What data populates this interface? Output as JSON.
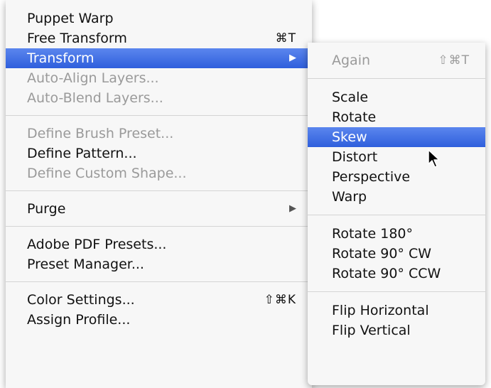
{
  "main_menu": {
    "items": [
      {
        "label": "Puppet Warp",
        "shortcut": "",
        "enabled": true
      },
      {
        "label": "Free Transform",
        "shortcut": "⌘T",
        "enabled": true
      },
      {
        "label": "Transform",
        "shortcut": "",
        "enabled": true,
        "highlighted": true,
        "submenu_arrow": "▶"
      },
      {
        "label": "Auto-Align Layers...",
        "shortcut": "",
        "enabled": false
      },
      {
        "label": "Auto-Blend Layers...",
        "shortcut": "",
        "enabled": false
      },
      {
        "label": "Define Brush Preset...",
        "shortcut": "",
        "enabled": false
      },
      {
        "label": "Define Pattern...",
        "shortcut": "",
        "enabled": true
      },
      {
        "label": "Define Custom Shape...",
        "shortcut": "",
        "enabled": false
      },
      {
        "label": "Purge",
        "shortcut": "",
        "enabled": true,
        "submenu_arrow": "▶"
      },
      {
        "label": "Adobe PDF Presets...",
        "shortcut": "",
        "enabled": true
      },
      {
        "label": "Preset Manager...",
        "shortcut": "",
        "enabled": true
      },
      {
        "label": "Color Settings...",
        "shortcut": "⇧⌘K",
        "enabled": true
      },
      {
        "label": "Assign Profile...",
        "shortcut": "",
        "enabled": true
      }
    ]
  },
  "transform_submenu": {
    "items": [
      {
        "label": "Again",
        "shortcut": "⇧⌘T",
        "enabled": false
      },
      {
        "label": "Scale",
        "enabled": true
      },
      {
        "label": "Rotate",
        "enabled": true
      },
      {
        "label": "Skew",
        "enabled": true,
        "highlighted": true
      },
      {
        "label": "Distort",
        "enabled": true
      },
      {
        "label": "Perspective",
        "enabled": true
      },
      {
        "label": "Warp",
        "enabled": true
      },
      {
        "label": "Rotate 180°",
        "enabled": true
      },
      {
        "label": "Rotate 90° CW",
        "enabled": true
      },
      {
        "label": "Rotate 90° CCW",
        "enabled": true
      },
      {
        "label": "Flip Horizontal",
        "enabled": true
      },
      {
        "label": "Flip Vertical",
        "enabled": true
      }
    ]
  },
  "colors": {
    "menu_background": "#f7f7f7",
    "highlight": "#3a6ae0",
    "disabled_text": "#9a9a9a",
    "separator": "#d4d4d4"
  },
  "icons": {
    "submenu_arrow": "triangle-right-icon",
    "pointer": "mouse-pointer-icon"
  }
}
